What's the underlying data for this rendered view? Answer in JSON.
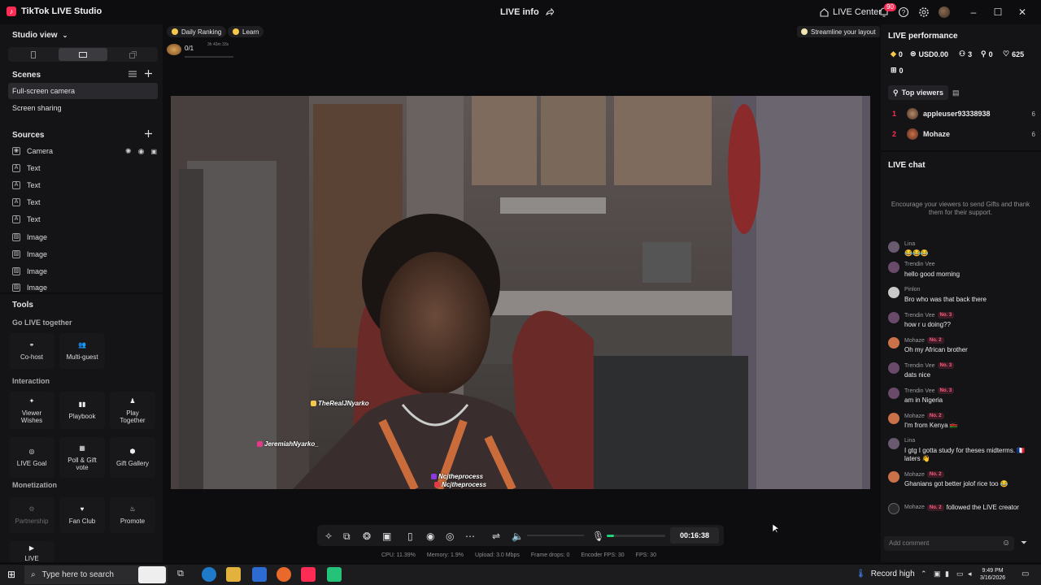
{
  "app": {
    "title": "TikTok LIVE Studio",
    "center_title": "LIVE info",
    "live_center": "LIVE Center",
    "notifications": "90"
  },
  "left": {
    "studio_view": "Studio view",
    "scenes_title": "Scenes",
    "scenes": [
      "Full-screen camera",
      "Screen sharing"
    ],
    "sources_title": "Sources",
    "sources": [
      {
        "label": "Camera",
        "icon": "camera-icon"
      },
      {
        "label": "Text",
        "icon": "text-icon"
      },
      {
        "label": "Text",
        "icon": "text-icon"
      },
      {
        "label": "Text",
        "icon": "text-icon"
      },
      {
        "label": "Text",
        "icon": "text-icon"
      },
      {
        "label": "Image",
        "icon": "image-icon"
      },
      {
        "label": "Image",
        "icon": "image-icon"
      },
      {
        "label": "Image",
        "icon": "image-icon"
      },
      {
        "label": "Image",
        "icon": "image-icon"
      }
    ],
    "tools_title": "Tools",
    "go_live_together": "Go LIVE together",
    "cohost": "Co-host",
    "multiguest": "Multi-guest",
    "interaction": "Interaction",
    "viewer_wishes": "Viewer Wishes",
    "playbook": "Playbook",
    "play_together": "Play Together",
    "live_goal": "LIVE Goal",
    "poll_gift": "Poll & Gift vote",
    "gift_gallery": "Gift Gallery",
    "monetization": "Monetization",
    "partnership": "Partnership",
    "fan_club": "Fan Club",
    "promote": "Promote",
    "live": "LIVE"
  },
  "top": {
    "daily_ranking": "Daily Ranking",
    "learn": "Learn",
    "ranking_value": "0/1",
    "ranking_time": "3h 43m 33s",
    "streamline": "Streamline your layout"
  },
  "video": {
    "overlay_1": "TheRealJNyarko",
    "overlay_2": "JeremiahNyarko_",
    "overlay_3": "Ncjtheprocess",
    "overlay_4": "Ncjtheprocess"
  },
  "controls": {
    "timer": "00:16:38",
    "volume_level": 0.12,
    "stats": [
      "CPU: 11.39%",
      "Memory: 1.9%",
      "Upload: 3.0 Mbps",
      "Frame drops: 0",
      "Encoder FPS: 30",
      "FPS: 30"
    ]
  },
  "right": {
    "perf_title": "LIVE performance",
    "metrics": [
      "0",
      "USD0.00",
      "3",
      "0",
      "625",
      "0"
    ],
    "top_viewers_tab": "Top viewers",
    "viewers": [
      {
        "rank": "1",
        "name": "appleuser93338938",
        "count": "6"
      },
      {
        "rank": "2",
        "name": "Mohaze",
        "count": "6"
      }
    ],
    "chat_title": "LIVE chat",
    "chat_hint": "Encourage your viewers to send Gifts and thank them for their support.",
    "chat_first_user": "Lina",
    "chat_first_text": "😂😂😂",
    "chat": [
      {
        "user": "Trendin Vee",
        "badge": "",
        "text": "hello good morning"
      },
      {
        "user": "Pinlon",
        "badge": "",
        "text": "Bro who was that back there"
      },
      {
        "user": "Trendin Vee",
        "badge": "No. 3",
        "text": "how r u doing??"
      },
      {
        "user": "Mohaze",
        "badge": "No. 2",
        "text": "Oh my African brother"
      },
      {
        "user": "Trendin Vee",
        "badge": "No. 3",
        "text": "dats nice"
      },
      {
        "user": "Trendin Vee",
        "badge": "No. 3",
        "text": "am in Nigeria"
      },
      {
        "user": "Mohaze",
        "badge": "No. 2",
        "text": "I'm from Kenya 🇰🇪"
      },
      {
        "user": "Lina",
        "badge": "",
        "text": "I gtg I gotta study for theses midterms. 🇫🇷 laters 👋"
      },
      {
        "user": "Mohaze",
        "badge": "No. 2",
        "text": "Ghanians got better jolof rice too 😂"
      }
    ],
    "follow_user": "Mohaze",
    "follow_badge": "No. 2",
    "follow_text": "followed the LIVE creator",
    "add_comment": "Add comment"
  },
  "taskbar": {
    "search": "Type here to search",
    "record": "Record high",
    "time": "9:49 PM",
    "date": "3/16/2026"
  }
}
